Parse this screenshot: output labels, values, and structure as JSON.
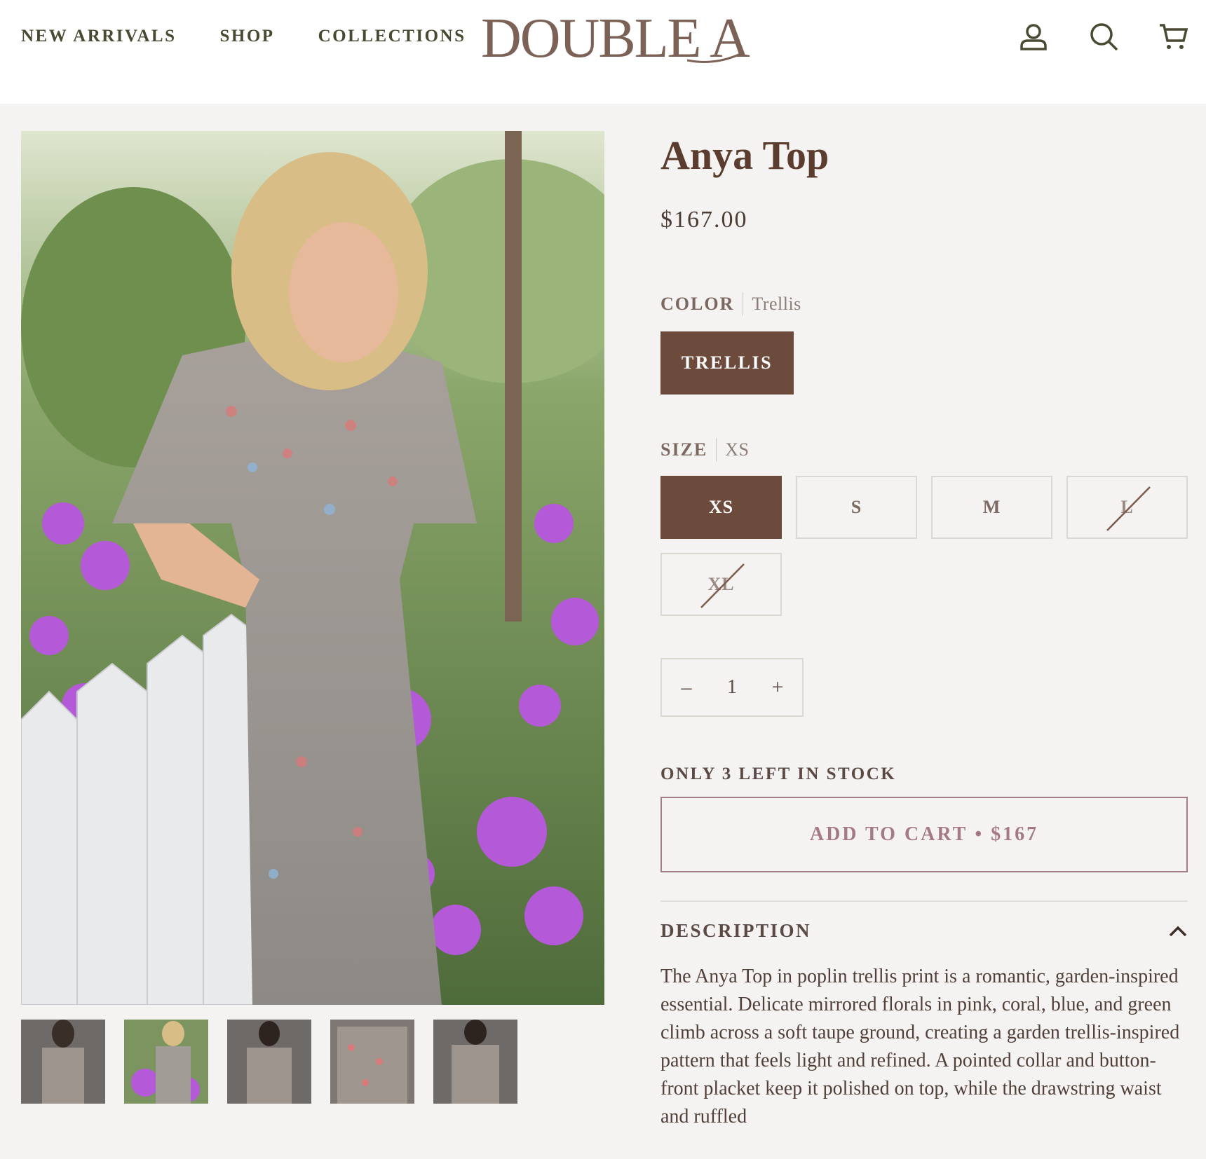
{
  "header": {
    "nav": [
      "NEW ARRIVALS",
      "SHOP",
      "COLLECTIONS"
    ],
    "logo": "DOUBLE A",
    "icons": [
      "account-icon",
      "search-icon",
      "cart-icon"
    ]
  },
  "gallery": {
    "thumbnail_count": 5,
    "active_thumbnail": 2
  },
  "product": {
    "title": "Anya Top",
    "price": "$167.00",
    "color_label": "COLOR",
    "color_value": "Trellis",
    "color_option": "TRELLIS",
    "size_label": "SIZE",
    "size_value": "XS",
    "sizes": [
      {
        "label": "XS",
        "state": "selected"
      },
      {
        "label": "S",
        "state": "available"
      },
      {
        "label": "M",
        "state": "available"
      },
      {
        "label": "L",
        "state": "soldout"
      },
      {
        "label": "XL",
        "state": "soldout"
      }
    ],
    "qty_minus": "–",
    "qty_value": "1",
    "qty_plus": "+",
    "stock_text": "ONLY 3 LEFT IN STOCK",
    "add_to_cart": "ADD TO CART",
    "cart_dot": "•",
    "cart_price": "$167",
    "description_label": "DESCRIPTION",
    "description": "The Anya Top in poplin trellis print is a romantic, garden-inspired essential. Delicate mirrored florals in pink, coral, blue, and green climb across a soft taupe ground, creating a garden trellis-inspired pattern that feels light and refined. A pointed collar and button-front placket keep it polished on top, while the drawstring waist and ruffled"
  },
  "colors": {
    "brand_brown": "#6c4b3c",
    "cart_border": "#a37d86",
    "background": "#f5f3f1"
  }
}
